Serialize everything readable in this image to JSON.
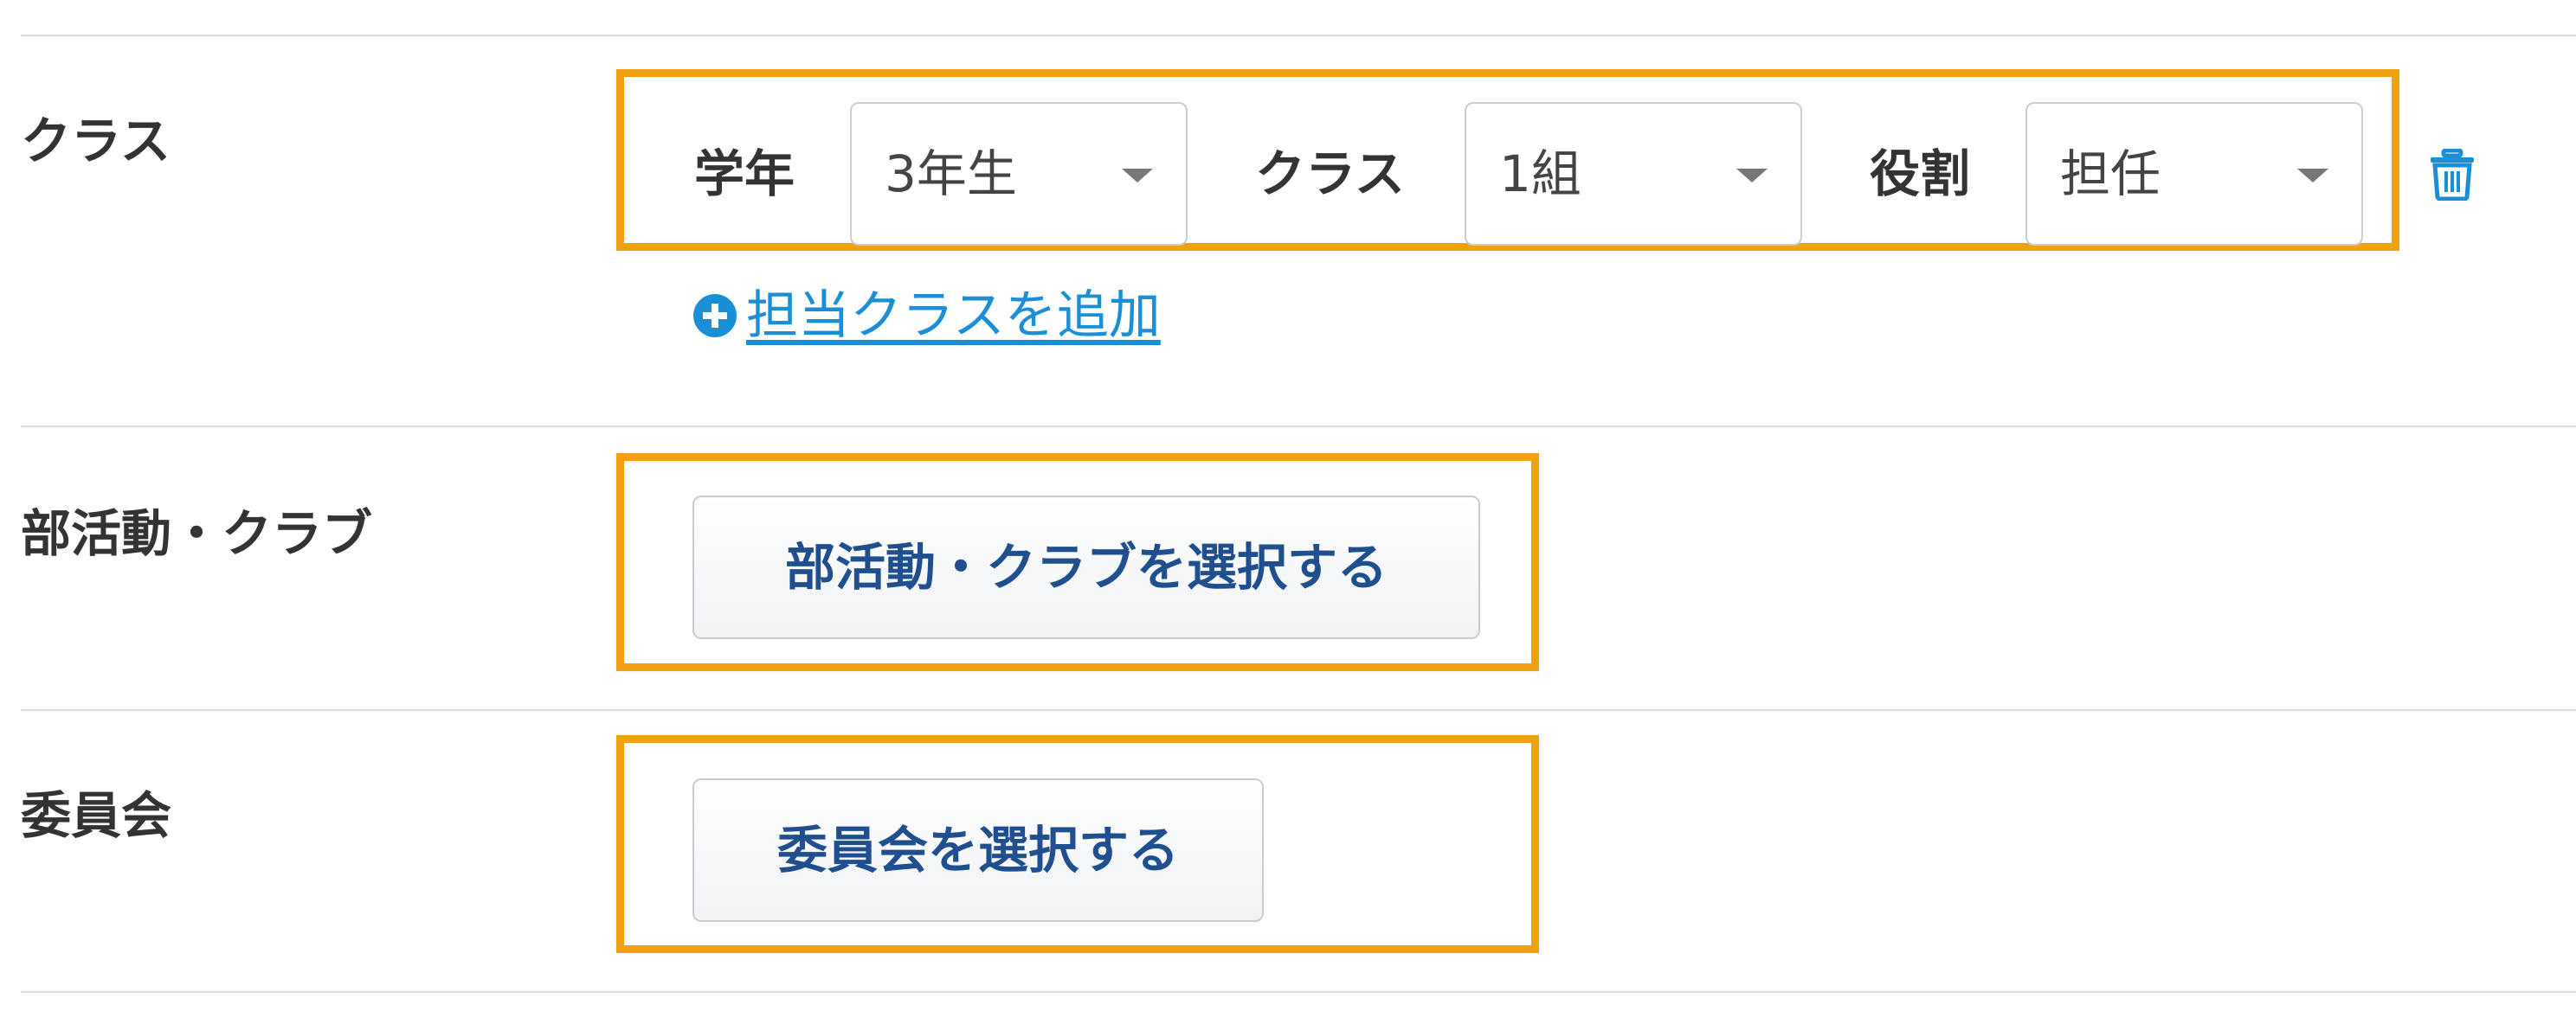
{
  "class_section": {
    "label": "クラス",
    "grade": {
      "label": "学年",
      "selected": "3年生"
    },
    "class": {
      "label": "クラス",
      "selected": "1組"
    },
    "role": {
      "label": "役割",
      "selected": "担任"
    },
    "delete_icon": "trash-icon",
    "add_link": {
      "icon": "plus-circle-icon",
      "text": "担当クラスを追加"
    }
  },
  "club_section": {
    "label": "部活動・クラブ",
    "button": "部活動・クラブを選択する"
  },
  "committee_section": {
    "label": "委員会",
    "button": "委員会を選択する"
  },
  "colors": {
    "highlight": "#f0a010",
    "link": "#1a8fd6",
    "button_text": "#1f4f8f",
    "divider": "#dddddd"
  }
}
